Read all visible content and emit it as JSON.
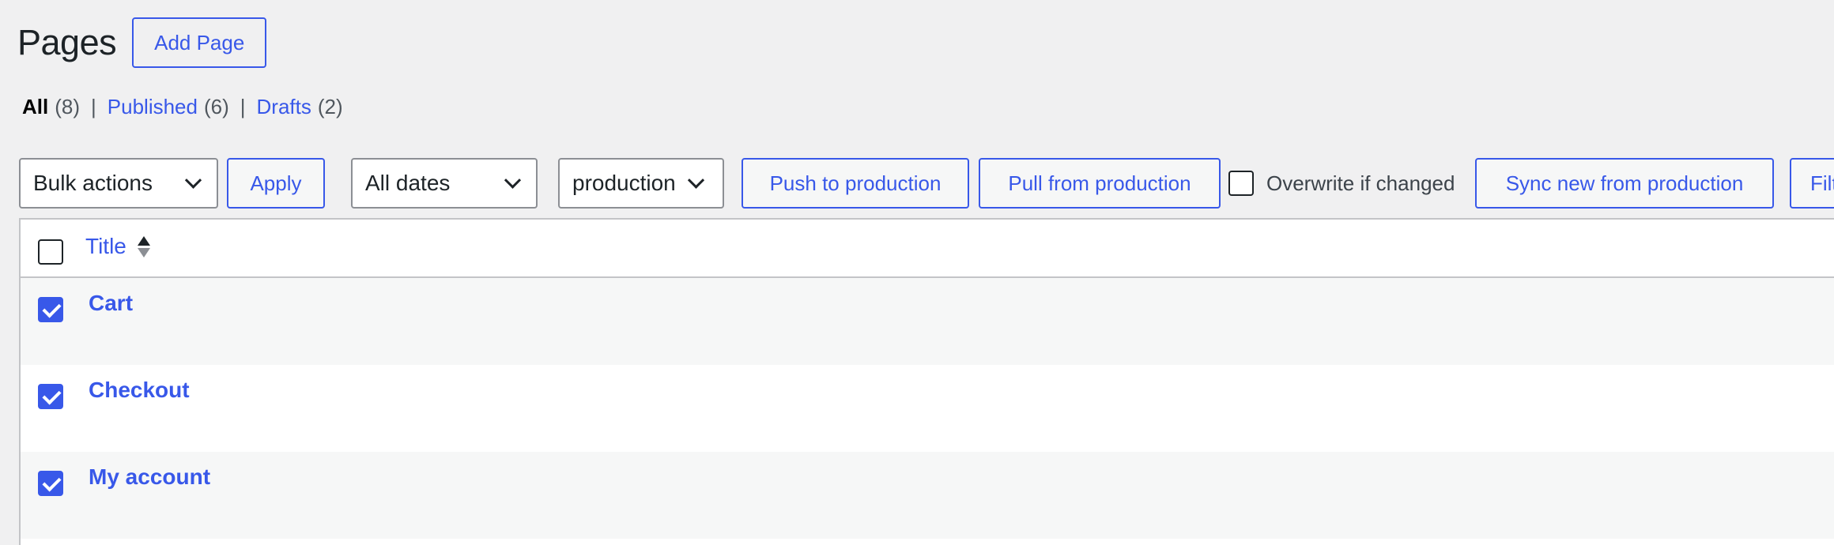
{
  "header": {
    "title": "Pages",
    "add_button": "Add Page"
  },
  "views": [
    {
      "label": "All",
      "count": "(8)",
      "current": true
    },
    {
      "label": "Published",
      "count": "(6)"
    },
    {
      "label": "Drafts",
      "count": "(2)"
    }
  ],
  "view_separator": "|",
  "tablenav": {
    "bulk_actions": {
      "selected": "Bulk actions"
    },
    "apply_label": "Apply",
    "dates": {
      "selected": "All dates"
    },
    "environment": {
      "selected": "production"
    },
    "push_label": "Push to production",
    "pull_label": "Pull from production",
    "overwrite_label": "Overwrite if changed",
    "overwrite_checked": false,
    "sync_label": "Sync new from production",
    "filter_label": "Filter"
  },
  "table": {
    "column_title": "Title",
    "select_all_checked": false,
    "rows": [
      {
        "title": "Cart",
        "checked": true
      },
      {
        "title": "Checkout",
        "checked": true
      },
      {
        "title": "My account",
        "checked": true
      }
    ]
  },
  "colors": {
    "accent": "#3858e9",
    "background": "#f0f0f1",
    "row_alt": "#f6f7f7"
  }
}
